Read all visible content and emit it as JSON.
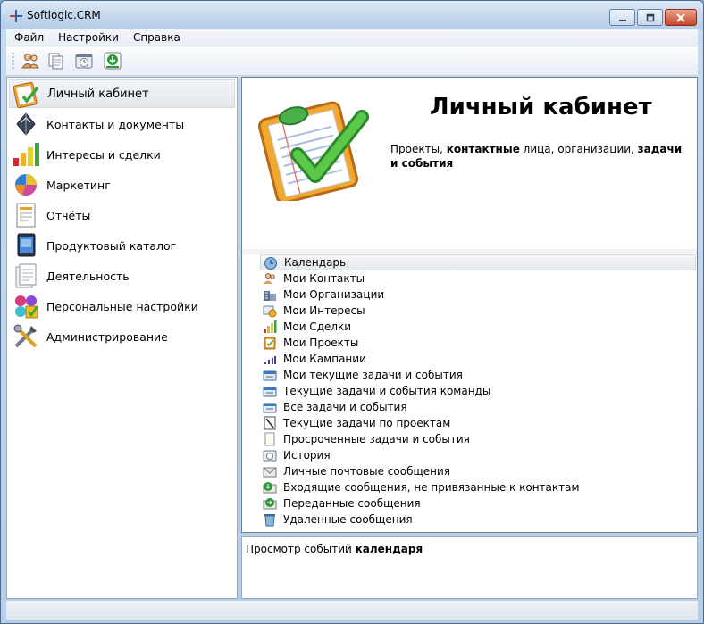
{
  "window": {
    "title": "Softlogic.CRM",
    "accent": "#3f6fa8"
  },
  "menu": {
    "file": "Файл",
    "settings": "Настройки",
    "help": "Справка"
  },
  "toolbar": {
    "icons": [
      "contacts-icon",
      "documents-icon",
      "history-icon",
      "download-icon"
    ]
  },
  "sidebar": {
    "items": [
      {
        "label": "Личный кабинет",
        "icon": "clipboard-check-icon",
        "selected": true
      },
      {
        "label": "Контакты и документы",
        "icon": "book-icon"
      },
      {
        "label": "Интересы и сделки",
        "icon": "bar-chart-icon"
      },
      {
        "label": "Маркетинг",
        "icon": "pie-chart-icon"
      },
      {
        "label": "Отчёты",
        "icon": "report-icon"
      },
      {
        "label": "Продуктовый каталог",
        "icon": "catalog-icon"
      },
      {
        "label": "Деятельность",
        "icon": "activity-icon"
      },
      {
        "label": "Персональные настройки",
        "icon": "personal-settings-icon"
      },
      {
        "label": "Администрирование",
        "icon": "tools-icon"
      }
    ]
  },
  "header": {
    "title": "Личный кабинет",
    "desc": {
      "p1": "Проекты, ",
      "b1": "контактные",
      "p2": " лица, организации, ",
      "b2": "задачи и события"
    }
  },
  "list": {
    "items": [
      {
        "label": "Календарь",
        "icon": "calendar-icon",
        "selected": true
      },
      {
        "label": "Мои Контакты",
        "icon": "contacts-icon"
      },
      {
        "label": "Мои Организации",
        "icon": "organizations-icon"
      },
      {
        "label": "Мои Интересы",
        "icon": "interests-icon"
      },
      {
        "label": "Мои Сделки",
        "icon": "deals-icon"
      },
      {
        "label": "Мои Проекты",
        "icon": "projects-icon"
      },
      {
        "label": "Мои Кампании",
        "icon": "campaigns-icon"
      },
      {
        "label": "Мои текущие задачи и события",
        "icon": "tasks-icon"
      },
      {
        "label": "Текущие задачи и события команды",
        "icon": "team-tasks-icon"
      },
      {
        "label": "Все задачи и события",
        "icon": "all-tasks-icon"
      },
      {
        "label": "Текущие задачи по проектам",
        "icon": "project-tasks-icon"
      },
      {
        "label": "Просроченные задачи и события",
        "icon": "overdue-icon"
      },
      {
        "label": "История",
        "icon": "history-icon"
      },
      {
        "label": "Личные почтовые сообщения",
        "icon": "mail-icon"
      },
      {
        "label": "Входящие сообщения, не привязанные к контактам",
        "icon": "inbox-icon"
      },
      {
        "label": "Переданные сообщения",
        "icon": "forwarded-icon"
      },
      {
        "label": "Удаленные сообщения",
        "icon": "deleted-icon"
      }
    ]
  },
  "preview": {
    "prefix": "Просмотр событий ",
    "bold": "календаря"
  }
}
